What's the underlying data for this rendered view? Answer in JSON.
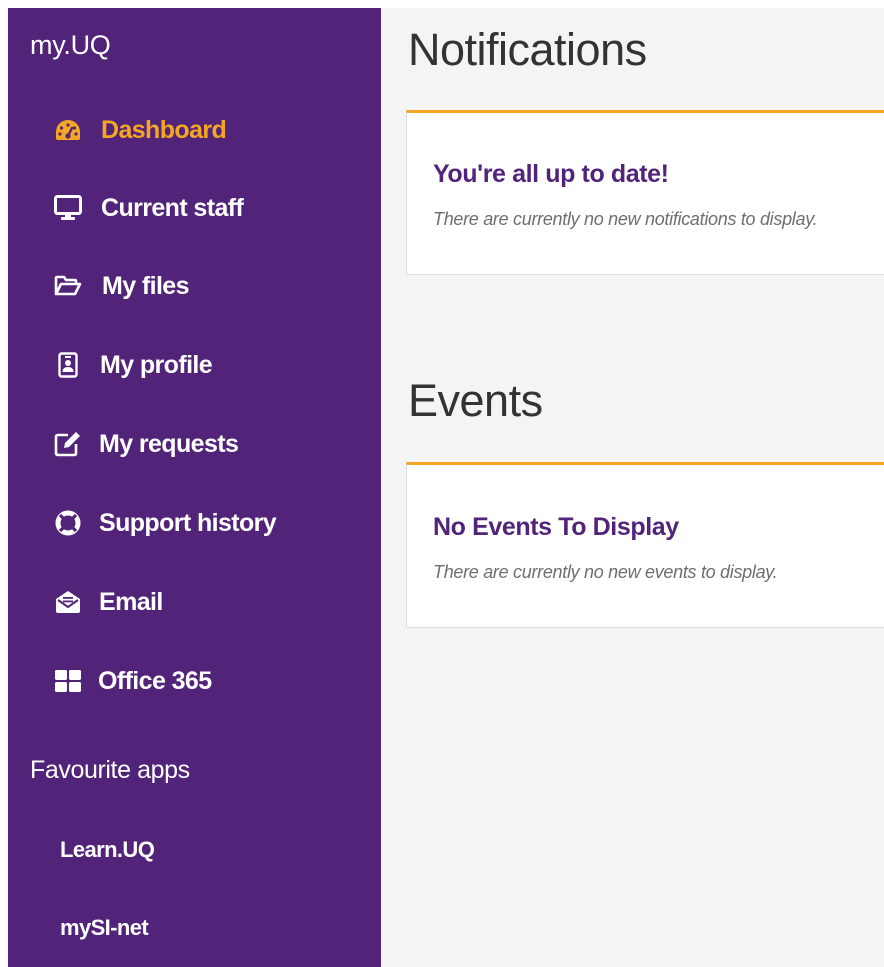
{
  "app": {
    "brand": "my.UQ"
  },
  "colors": {
    "sidebar": "#51247a",
    "accent": "#f5a623",
    "heading": "#51247a"
  },
  "sidebar": {
    "items": [
      {
        "label": "Dashboard",
        "icon": "dashboard-gauge-icon",
        "active": true
      },
      {
        "label": "Current staff",
        "icon": "desktop-monitor-icon"
      },
      {
        "label": "My files",
        "icon": "folder-open-icon"
      },
      {
        "label": "My profile",
        "icon": "id-badge-icon"
      },
      {
        "label": "My requests",
        "icon": "edit-square-icon"
      },
      {
        "label": "Support history",
        "icon": "life-ring-icon"
      },
      {
        "label": "Email",
        "icon": "envelope-open-icon"
      },
      {
        "label": "Office 365",
        "icon": "office-grid-icon"
      }
    ],
    "favourites_heading": "Favourite apps",
    "favourites": [
      {
        "label": "Learn.UQ"
      },
      {
        "label": "mySI-net"
      }
    ]
  },
  "main": {
    "notifications": {
      "title": "Notifications",
      "card_title": "You're all up to date!",
      "card_text": "There are currently no new notifications to display."
    },
    "events": {
      "title": "Events",
      "card_title": "No Events To Display",
      "card_text": "There are currently no new events to display."
    }
  }
}
